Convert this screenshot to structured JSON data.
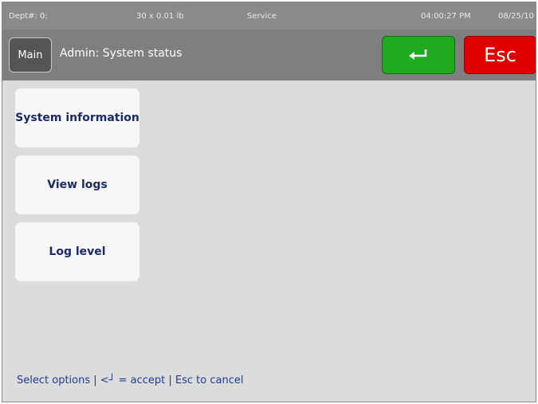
{
  "status": {
    "dept": "Dept#: 0:",
    "weight": "30 x 0.01 lb",
    "mode": "Service",
    "time": "04:00:27 PM",
    "date": "08/25/10"
  },
  "header": {
    "main_label": "Main",
    "title": "Admin: System status",
    "esc_label": "Esc"
  },
  "menu": [
    {
      "label": "System information"
    },
    {
      "label": "View logs"
    },
    {
      "label": "Log level"
    }
  ],
  "footer": {
    "help": "Select options | <┘ = accept | Esc to cancel"
  },
  "colors": {
    "accept": "#1faa1f",
    "cancel": "#e00000"
  }
}
